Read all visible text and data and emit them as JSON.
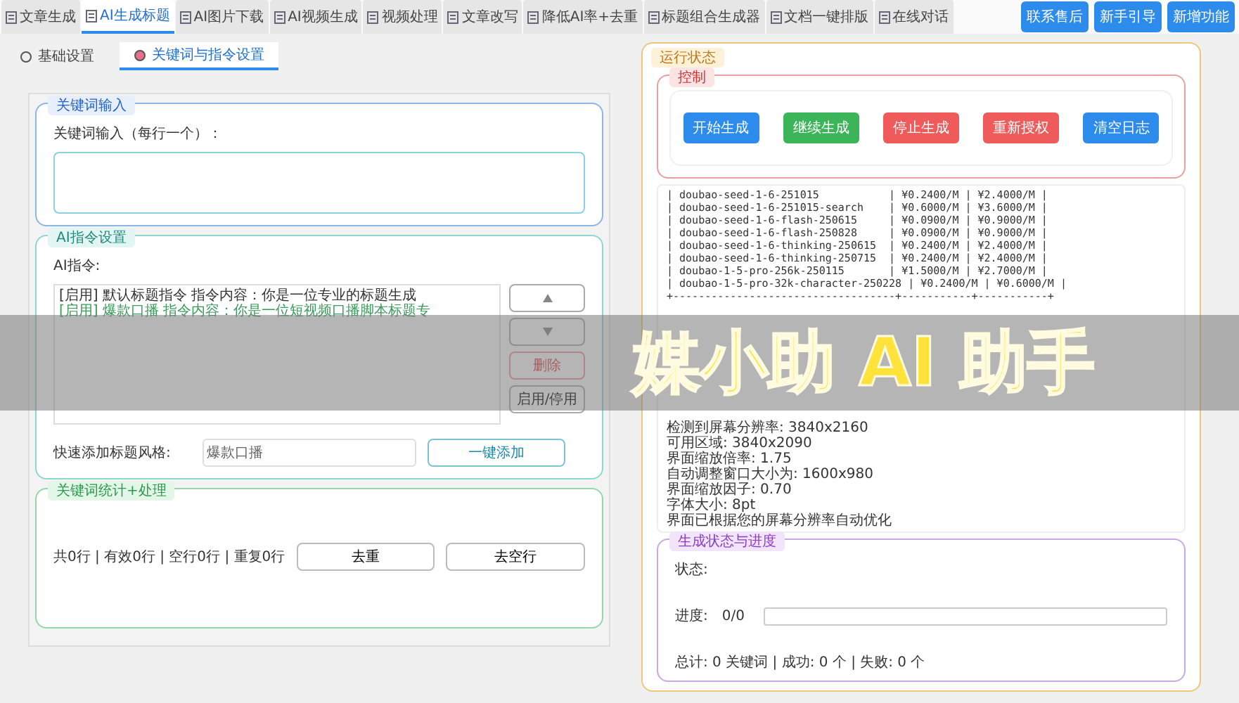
{
  "top_tabs": [
    {
      "label": "文章生成",
      "selected": false
    },
    {
      "label": "AI生成标题",
      "selected": true
    },
    {
      "label": "AI图片下载",
      "selected": false
    },
    {
      "label": "AI视频生成",
      "selected": false
    },
    {
      "label": "视频处理",
      "selected": false
    },
    {
      "label": "文章改写",
      "selected": false
    },
    {
      "label": "降低AI率+去重",
      "selected": false
    },
    {
      "label": "标题组合生成器",
      "selected": false
    },
    {
      "label": "文档一键排版",
      "selected": false
    },
    {
      "label": "在线对话",
      "selected": false
    }
  ],
  "header_buttons": [
    "联系售后",
    "新手引导",
    "新增功能"
  ],
  "sub_tabs": [
    {
      "label": "基础设置",
      "selected": false
    },
    {
      "label": "关键词与指令设置",
      "selected": true
    }
  ],
  "keyword_input": {
    "title": "关键词输入",
    "label": "关键词输入（每行一个）："
  },
  "ai_instructions": {
    "title": "AI指令设置",
    "label": "AI指令:",
    "items": [
      {
        "text": "[启用] 默认标题指令  指令内容：你是一位专业的标题生成",
        "color": "#333333"
      },
      {
        "text": "[启用] 爆款口播  指令内容：你是一位短视频口播脚本标题专",
        "color": "#3a9a5a"
      }
    ],
    "delete_button": "删除",
    "toggle_button": "启用/停用",
    "quick_add_label": "快速添加标题风格:",
    "quick_add_value": "爆款口播",
    "quick_add_button": "一键添加"
  },
  "keyword_stats": {
    "title": "关键词统计+处理",
    "summary": "共0行 | 有效0行 | 空行0行 | 重复0行",
    "buttons": [
      "去重",
      "去空行"
    ]
  },
  "run_status": {
    "title": "运行状态",
    "control": {
      "title": "控制",
      "buttons": [
        {
          "label": "开始生成",
          "color": "#2d8ceb"
        },
        {
          "label": "继续生成",
          "color": "#3cb55a"
        },
        {
          "label": "停止生成",
          "color": "#ef5a5a"
        },
        {
          "label": "重新授权",
          "color": "#ef5a5a"
        },
        {
          "label": "清空日志",
          "color": "#2d8ceb"
        }
      ]
    },
    "log_lines": [
      "| doubao-seed-1-6-251015           | ¥0.2400/M | ¥2.4000/M |",
      "| doubao-seed-1-6-251015-search    | ¥0.6000/M | ¥3.6000/M |",
      "| doubao-seed-1-6-flash-250615     | ¥0.0900/M | ¥0.9000/M |",
      "| doubao-seed-1-6-flash-250828     | ¥0.0900/M | ¥0.9000/M |",
      "| doubao-seed-1-6-thinking-250615  | ¥0.2400/M | ¥2.4000/M |",
      "| doubao-seed-1-6-thinking-250715  | ¥0.2400/M | ¥2.4000/M |",
      "| doubao-1-5-pro-256k-250115       | ¥1.5000/M | ¥2.7000/M |",
      "| doubao-1-5-pro-32k-character-250228 | ¥0.2400/M | ¥0.6000/M |",
      "+-----------------------------------+-----------+-----------+"
    ],
    "info_lines": [
      "检测到屏幕分辨率: 3840x2160",
      "可用区域: 3840x2090",
      "界面缩放倍率: 1.75",
      "自动调整窗口大小为: 1600x980",
      "界面缩放因子: 0.70",
      "字体大小: 8pt",
      "界面已根据您的屏幕分辨率自动优化"
    ]
  },
  "progress": {
    "title": "生成状态与进度",
    "status_label": "状态:",
    "progress_label": "进度:",
    "progress_count": "0/0",
    "level": 0,
    "totals": "总计: 0 关键词 | 成功: 0 个 | 失败: 0 个"
  },
  "banner": "媒小助 AI 助手"
}
